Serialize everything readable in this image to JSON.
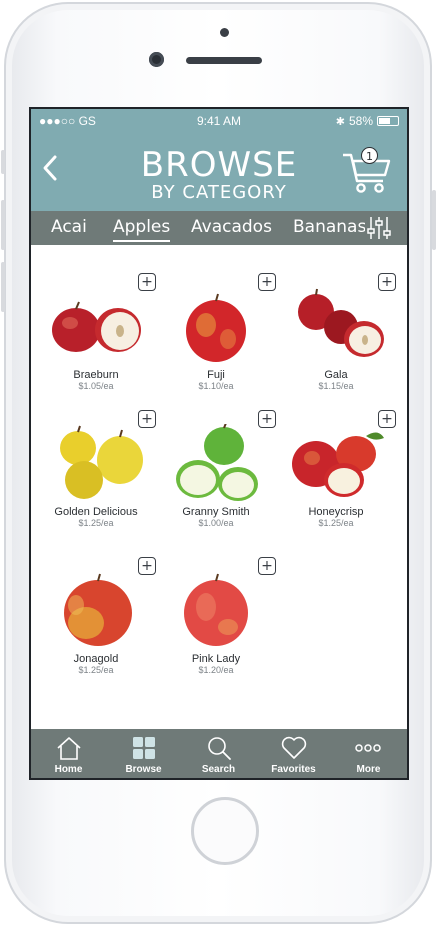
{
  "status_bar": {
    "carrier": "●●●○○ GS",
    "time": "9:41 AM",
    "battery": "58%"
  },
  "header": {
    "title": "BROWSE",
    "subtitle": "BY CATEGORY",
    "cart_count": "1",
    "accent_color": "#80abb1"
  },
  "tabs": [
    "Acai",
    "Apples",
    "Avacados",
    "Bananas"
  ],
  "active_tab": "Apples",
  "products": [
    {
      "name": "Braeburn",
      "price": "$1.05/ea"
    },
    {
      "name": "Fuji",
      "price": "$1.10/ea"
    },
    {
      "name": "Gala",
      "price": "$1.15/ea"
    },
    {
      "name": "Golden Delicious",
      "price": "$1.25/ea"
    },
    {
      "name": "Granny Smith",
      "price": "$1.00/ea"
    },
    {
      "name": "Honeycrisp",
      "price": "$1.25/ea"
    },
    {
      "name": "Jonagold",
      "price": "$1.25/ea"
    },
    {
      "name": "Pink Lady",
      "price": "$1.20/ea"
    }
  ],
  "tab_bar": [
    {
      "label": "Home",
      "icon": "home-icon"
    },
    {
      "label": "Browse",
      "icon": "grid-icon"
    },
    {
      "label": "Search",
      "icon": "search-icon"
    },
    {
      "label": "Favorites",
      "icon": "heart-icon"
    },
    {
      "label": "More",
      "icon": "more-icon"
    }
  ]
}
